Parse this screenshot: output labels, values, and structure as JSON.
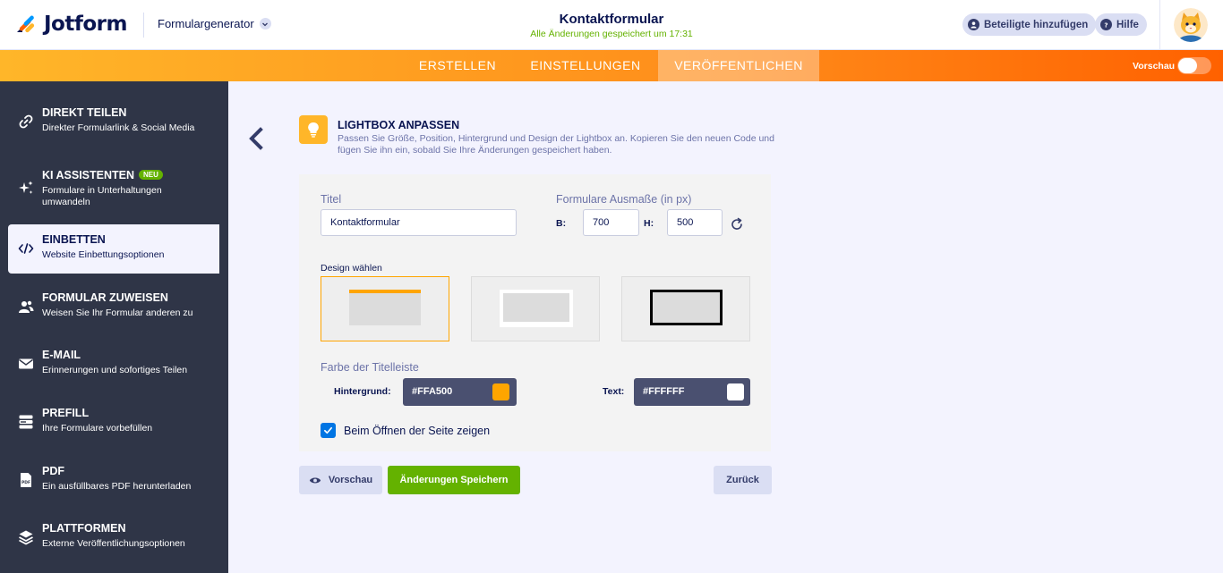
{
  "header": {
    "brand": "Jotform",
    "product": "Formulargenerator",
    "form_title": "Kontaktformular",
    "saved_status": "Alle Änderungen gespeichert um 17:31",
    "invite_label": "Beteiligte hinzufügen",
    "help_label": "Hilfe"
  },
  "nav": {
    "tabs": [
      {
        "label": "ERSTELLEN"
      },
      {
        "label": "EINSTELLUNGEN"
      },
      {
        "label": "VERÖFFENTLICHEN"
      }
    ],
    "active_tab": "VERÖFFENTLICHEN",
    "preview_label": "Vorschau"
  },
  "sidebar": {
    "items": [
      {
        "title": "DIREKT TEILEN",
        "subtitle": "Direkter Formularlink & Social Media",
        "icon": "link-icon"
      },
      {
        "title": "KI ASSISTENTEN",
        "badge": "NEU",
        "subtitle": "Formulare in Unterhaltungen",
        "subtitle2": "umwandeln",
        "icon": "sparkle-icon"
      },
      {
        "title": "EINBETTEN",
        "subtitle": "Website Einbettungsoptionen",
        "icon": "code-icon"
      },
      {
        "title": "FORMULAR ZUWEISEN",
        "subtitle": "Weisen Sie Ihr Formular anderen zu",
        "icon": "users-icon"
      },
      {
        "title": "E-MAIL",
        "subtitle": "Erinnerungen und sofortiges Teilen",
        "icon": "envelope-icon"
      },
      {
        "title": "PREFILL",
        "subtitle": "Ihre Formulare vorbefüllen",
        "icon": "prefill-icon"
      },
      {
        "title": "PDF",
        "subtitle": "Ein ausfüllbares PDF herunterladen",
        "icon": "pdf-icon"
      },
      {
        "title": "PLATTFORMEN",
        "subtitle": "Externe Veröffentlichungsoptionen",
        "icon": "layers-icon"
      }
    ],
    "active_item": "EINBETTEN"
  },
  "lightbox": {
    "title": "LIGHTBOX ANPASSEN",
    "description": "Passen Sie Größe, Position, Hintergrund und Design der Lightbox an. Kopieren Sie den neuen Code und fügen Sie ihn ein, sobald Sie Ihre Änderungen gespeichert haben.",
    "title_label": "Titel",
    "title_value": "Kontaktformular",
    "dimensions_label": "Formulare Ausmaße (in px)",
    "width_label": "B:",
    "width_value": "700",
    "height_label": "H:",
    "height_value": "500",
    "design_label": "Design wählen",
    "selected_design": 1,
    "titlebar_color_label": "Farbe der Titelleiste",
    "background_label": "Hintergrund:",
    "background_value": "#FFA500",
    "text_label": "Text:",
    "text_value": "#FFFFFF",
    "show_on_open_label": "Beim Öffnen der Seite zeigen",
    "show_on_open": true
  },
  "actions": {
    "preview_label": "Vorschau",
    "save_label": "Änderungen Speichern",
    "back_label": "Zurück"
  },
  "colors": {
    "accent_orange": "#FFA500",
    "sidebar_bg": "#2F3547",
    "save_green": "#64B200",
    "checkbox_blue": "#0075E3"
  }
}
